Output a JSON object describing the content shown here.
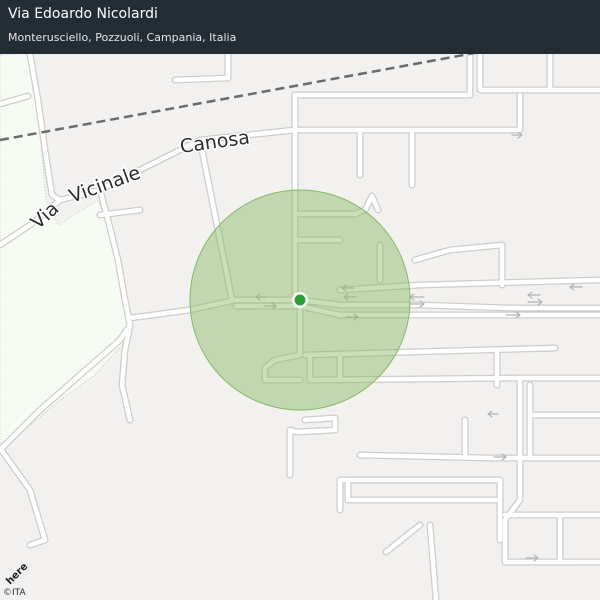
{
  "header": {
    "title": "Via Edoardo Nicolardi",
    "subtitle": "Monterusciello, Pozzuoli, Campania, Italia"
  },
  "map": {
    "street_labels": [
      "Via",
      "Vicinale",
      "Canosa"
    ],
    "marker": {
      "color": "#2e9e3a"
    },
    "accuracy_circle": {
      "color": "#86b961"
    },
    "colors": {
      "background": "#f2f1f0",
      "park": "#f5fbf3",
      "road_fill": "#ffffff",
      "road_casing": "#cfcdca",
      "railway": "#6b6b6b",
      "arrow": "#b4b4b4",
      "header_bg": "#232d36"
    }
  },
  "branding": {
    "logo_text": "here",
    "copyright": "©ITA"
  }
}
